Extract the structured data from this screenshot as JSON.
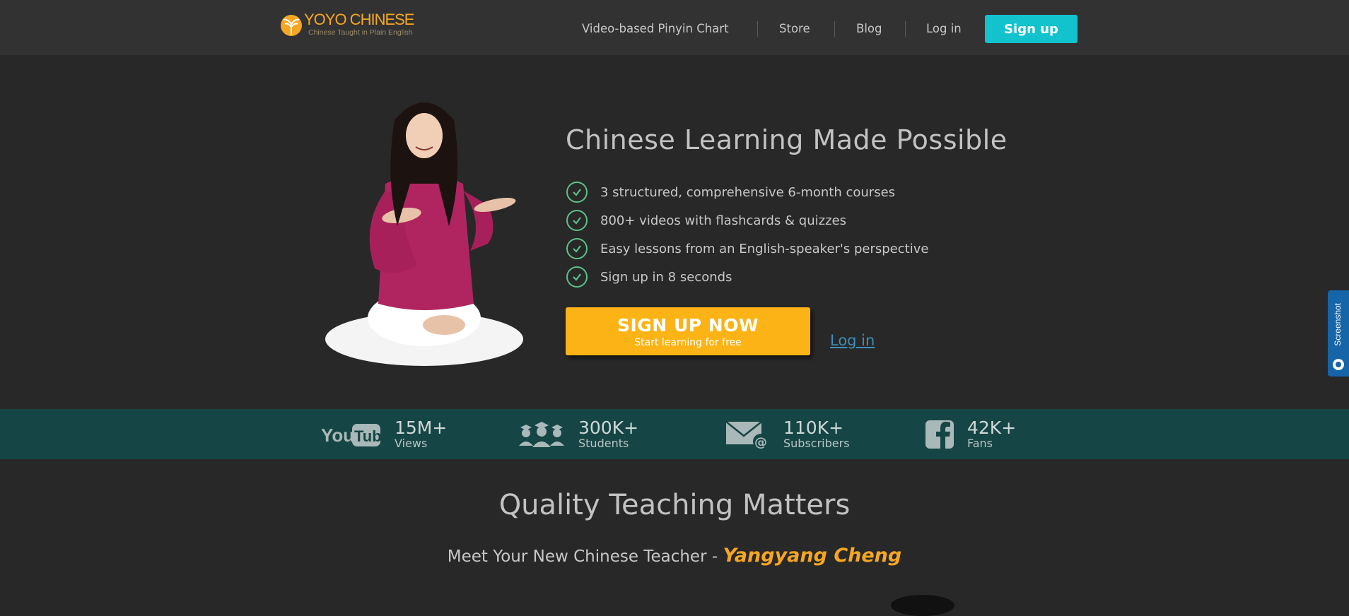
{
  "header": {
    "logo": {
      "title": "YOYO CHINESE",
      "tagline": "Chinese Taught in Plain English",
      "icon": "yoyo-logo-icon"
    },
    "nav": [
      {
        "label": "Video-based Pinyin Chart"
      },
      {
        "label": "Store"
      },
      {
        "label": "Blog"
      },
      {
        "label": "Log in"
      }
    ],
    "signup_label": "Sign up"
  },
  "hero": {
    "title": "Chinese Learning Made Possible",
    "features": [
      "3 structured, comprehensive 6-month courses",
      "800+ videos with flashcards & quizzes",
      "Easy lessons from an English-speaker's perspective",
      "Sign up in 8 seconds"
    ],
    "cta_title": "SIGN UP NOW",
    "cta_subtitle": "Start learning for free",
    "login_label": "Log in"
  },
  "stats": [
    {
      "icon": "youtube-icon",
      "value": "15M+",
      "label": "Views"
    },
    {
      "icon": "students-icon",
      "value": "300K+",
      "label": "Students"
    },
    {
      "icon": "email-icon",
      "value": "110K+",
      "label": "Subscribers"
    },
    {
      "icon": "facebook-icon",
      "value": "42K+",
      "label": "Fans"
    }
  ],
  "quality": {
    "title": "Quality Teaching Matters",
    "subtitle_prefix": "Meet Your New Chinese Teacher - ",
    "teacher_name": "Yangyang Cheng"
  },
  "screenshot_tab": {
    "label": "Screenshot"
  },
  "colors": {
    "background": "#282828",
    "topbar": "#323232",
    "accent_teal": "#12c3ce",
    "cta_orange": "#fcb316",
    "stats_band": "#164545",
    "check_green": "#5cc08a",
    "link_blue": "#3d8fb8"
  }
}
